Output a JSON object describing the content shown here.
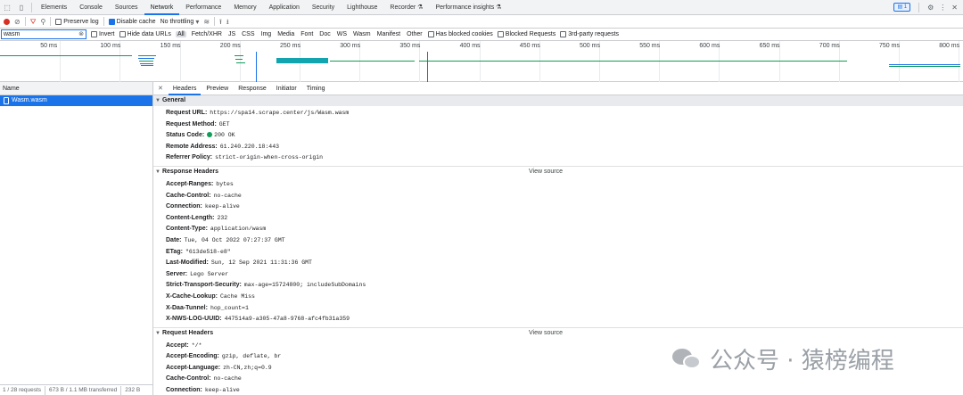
{
  "tabs": [
    "Elements",
    "Console",
    "Sources",
    "Network",
    "Performance",
    "Memory",
    "Application",
    "Security",
    "Lighthouse",
    "Recorder ⚗",
    "Performance insights ⚗"
  ],
  "active_tab": "Network",
  "issues_badge": "1",
  "toolbar": {
    "preserve_log": "Preserve log",
    "disable_cache": "Disable cache",
    "throttling": "No throttling"
  },
  "filter": {
    "value": "wasm",
    "invert": "Invert",
    "hide_data_urls": "Hide data URLs",
    "types": [
      "All",
      "Fetch/XHR",
      "JS",
      "CSS",
      "Img",
      "Media",
      "Font",
      "Doc",
      "WS",
      "Wasm",
      "Manifest",
      "Other"
    ],
    "blocked_cookies": "Has blocked cookies",
    "blocked_requests": "Blocked Requests",
    "third_party": "3rd-party requests"
  },
  "timeline_ticks": [
    "50 ms",
    "100 ms",
    "150 ms",
    "200 ms",
    "250 ms",
    "300 ms",
    "350 ms",
    "400 ms",
    "450 ms",
    "500 ms",
    "550 ms",
    "600 ms",
    "650 ms",
    "700 ms",
    "750 ms",
    "800 ms"
  ],
  "request_list": {
    "header": "Name",
    "items": [
      "Wasm.wasm"
    ]
  },
  "status_bar": {
    "requests": "1 / 28 requests",
    "transferred": "673 B / 1.1 MB transferred",
    "resources": "232 B"
  },
  "detail_tabs": [
    "Headers",
    "Preview",
    "Response",
    "Initiator",
    "Timing"
  ],
  "general": {
    "title": "General",
    "rows": [
      {
        "k": "Request URL:",
        "v": "https://spa14.scrape.center/js/Wasm.wasm"
      },
      {
        "k": "Request Method:",
        "v": "GET"
      },
      {
        "k": "Status Code:",
        "v": "200 OK"
      },
      {
        "k": "Remote Address:",
        "v": "61.240.220.18:443"
      },
      {
        "k": "Referrer Policy:",
        "v": "strict-origin-when-cross-origin"
      }
    ]
  },
  "response_headers": {
    "title": "Response Headers",
    "view_source": "View source",
    "rows": [
      {
        "k": "Accept-Ranges:",
        "v": "bytes"
      },
      {
        "k": "Cache-Control:",
        "v": "no-cache"
      },
      {
        "k": "Connection:",
        "v": "keep-alive"
      },
      {
        "k": "Content-Length:",
        "v": "232"
      },
      {
        "k": "Content-Type:",
        "v": "application/wasm"
      },
      {
        "k": "Date:",
        "v": "Tue, 04 Oct 2022 07:27:37 GMT"
      },
      {
        "k": "ETag:",
        "v": "\"613de518-e8\""
      },
      {
        "k": "Last-Modified:",
        "v": "Sun, 12 Sep 2021 11:31:36 GMT"
      },
      {
        "k": "Server:",
        "v": "Lego Server"
      },
      {
        "k": "Strict-Transport-Security:",
        "v": "max-age=15724800; includeSubDomains"
      },
      {
        "k": "X-Cache-Lookup:",
        "v": "Cache Miss"
      },
      {
        "k": "X-Daa-Tunnel:",
        "v": "hop_count=1"
      },
      {
        "k": "X-NWS-LOG-UUID:",
        "v": "447514a9-a305-47a8-9768-afc4fb31a359"
      }
    ]
  },
  "request_headers": {
    "title": "Request Headers",
    "view_source": "View source",
    "rows": [
      {
        "k": "Accept:",
        "v": "*/*"
      },
      {
        "k": "Accept-Encoding:",
        "v": "gzip, deflate, br"
      },
      {
        "k": "Accept-Language:",
        "v": "zh-CN,zh;q=0.9"
      },
      {
        "k": "Cache-Control:",
        "v": "no-cache"
      },
      {
        "k": "Connection:",
        "v": "keep-alive"
      }
    ]
  },
  "watermark": "公众号 · 猿榜编程",
  "colors": {
    "accent": "#1a73e8",
    "record": "#d93025",
    "status_ok": "#0f9d58"
  }
}
